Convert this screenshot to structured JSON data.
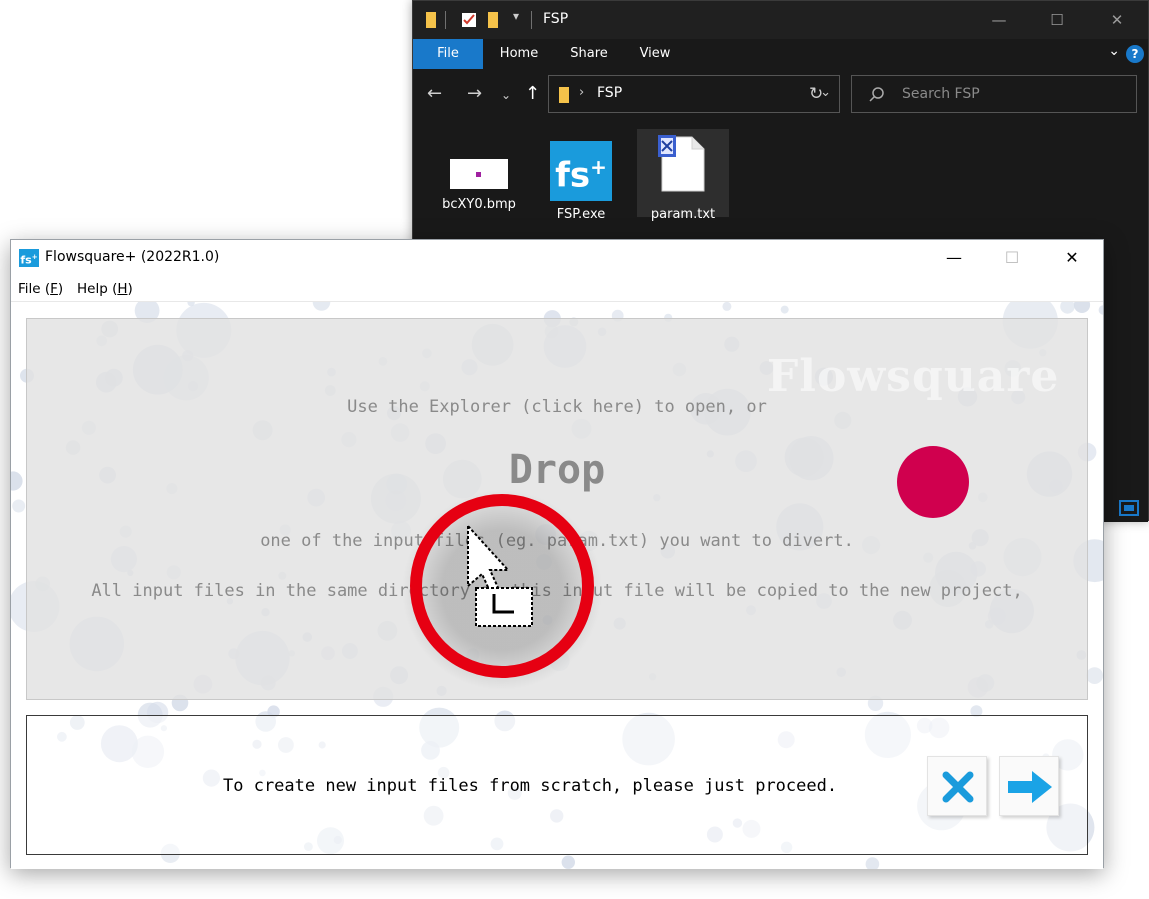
{
  "explorer": {
    "title": "FSP",
    "ribbon_tabs": [
      "File",
      "Home",
      "Share",
      "View"
    ],
    "address_path": "FSP",
    "search_placeholder": "Search FSP",
    "files": [
      {
        "name": "bcXY0.bmp",
        "icon": "bitmap-file-icon"
      },
      {
        "name": "FSP.exe",
        "icon": "flowsquare-app-icon"
      },
      {
        "name": "param.txt",
        "icon": "text-file-icon"
      }
    ],
    "help_glyph": "?"
  },
  "app": {
    "title": "Flowsquare+ (2022R1.0)",
    "logo_text": "fs",
    "logo_sup": "+",
    "menu": [
      {
        "label": "File (",
        "key": "F",
        "end": ")"
      },
      {
        "label": "Help (",
        "key": "H",
        "end": ")"
      }
    ],
    "drop_panel": {
      "line1": "Use the Explorer (click here) to open, or",
      "line2": "Drop",
      "line3": "one of the input files (eg. param.txt) you want to divert.",
      "line4": "All input files in the same directory as this input file will be copied to the new project,",
      "watermark": "Flowsquare"
    },
    "proceed_panel": {
      "message": "To create new input files from scratch, please just proceed."
    },
    "colors": {
      "accent_blue": "#1a9bdc",
      "highlight_red": "#e60012",
      "dot_magenta": "#d0004e",
      "explorer_blue": "#1979ca"
    }
  }
}
